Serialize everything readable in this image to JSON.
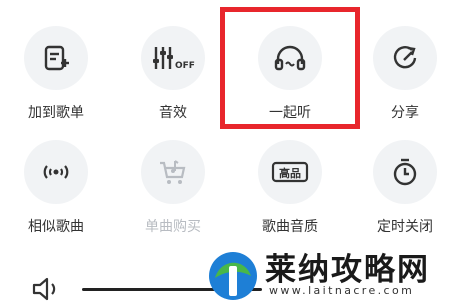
{
  "actions": {
    "add_to_playlist": "加到歌单",
    "sound_effects": "音效",
    "listen_together": "一起听",
    "share": "分享",
    "similar_songs": "相似歌曲",
    "buy_single": "单曲购买",
    "audio_quality": "歌曲音质",
    "sleep_timer": "定时关闭"
  },
  "badges": {
    "sound_effects_off": "OFF",
    "audio_quality": "高品"
  },
  "watermark": {
    "title": "莱纳攻略网",
    "url": "www.laitnacre.com"
  },
  "colors": {
    "highlight": "#e8262c",
    "icon": "#333333",
    "disabled": "#b8bcc2",
    "circle": "#f1f3f5"
  }
}
